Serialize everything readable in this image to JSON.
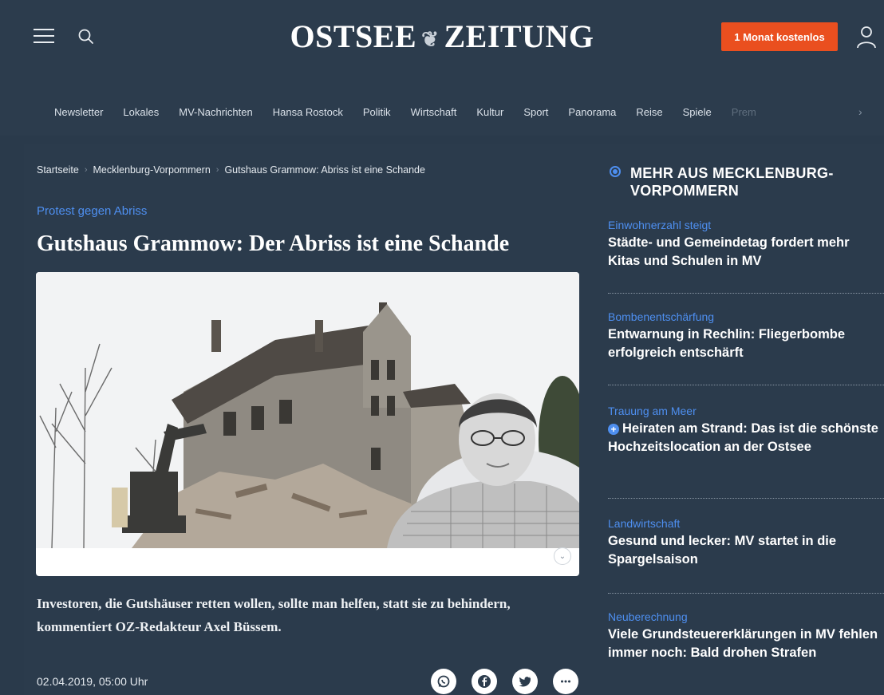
{
  "header": {
    "logo_left": "OSTSEE",
    "logo_right": "ZEITUNG",
    "cta_label": "1 Monat kostenlos"
  },
  "nav": {
    "items": [
      "Newsletter",
      "Lokales",
      "MV-Nachrichten",
      "Hansa Rostock",
      "Politik",
      "Wirtschaft",
      "Kultur",
      "Sport",
      "Panorama",
      "Reise",
      "Spiele",
      "Prem"
    ]
  },
  "breadcrumb": [
    "Startseite",
    "Mecklenburg-Vorpommern",
    "Gutshaus Grammow: Abriss ist eine Schande"
  ],
  "article": {
    "kicker": "Protest gegen Abriss",
    "headline": "Gutshaus Grammow: Der Abriss ist eine Schande",
    "lead": "Investoren, die Gutshäuser retten wollen, sollte man helfen, statt sie zu behindern, kommentiert OZ-Redakteur Axel Büssem.",
    "date": "02.04.2019, 05:00 Uhr"
  },
  "sidebar": {
    "title": "MEHR AUS MECKLENBURG-VORPOMMERN",
    "stories": [
      {
        "kicker": "Einwohnerzahl steigt",
        "headline": "Städte- und Gemeindetag fordert mehr Kitas und Schulen in MV"
      },
      {
        "kicker": "Bombenentschärfung",
        "headline": "Entwarnung in Rechlin: Fliegerbombe erfolgreich entschärft"
      },
      {
        "kicker": "Trauung am Meer",
        "headline": "Heiraten am Strand: Das ist die schönste Hochzeitslocation an der Ostsee",
        "plus": true
      },
      {
        "kicker": "Landwirtschaft",
        "headline": "Gesund und lecker: MV startet in die Spargelsaison"
      },
      {
        "kicker": "Neuberechnung",
        "headline": "Viele Grundsteuererklärungen in MV fehlen immer noch: Bald drohen Strafen"
      }
    ]
  },
  "colors": {
    "background": "#2b3b4c",
    "accent_blue": "#4e8ff0",
    "cta_orange": "#ea4f1f"
  }
}
